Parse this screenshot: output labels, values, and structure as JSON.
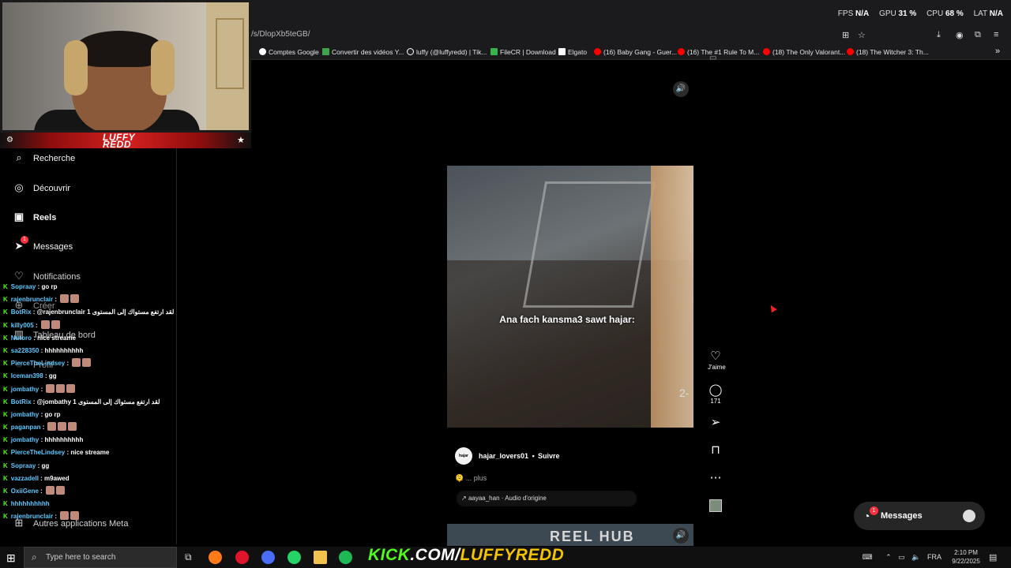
{
  "browser": {
    "url": "/s/DlopXb5teGB/",
    "bookmarks": [
      {
        "label": "Comptes Google",
        "icon": "google-icon"
      },
      {
        "label": "Convertir des vidéos Y...",
        "icon": "download-icon"
      },
      {
        "label": "luffy (@luffyredd) | Tik...",
        "icon": "tiktok-icon"
      },
      {
        "label": "FileCR | Download",
        "icon": "filecr-icon"
      },
      {
        "label": "Elgato",
        "icon": "elgato-icon"
      },
      {
        "label": "(16) Baby Gang - Guer...",
        "icon": "youtube-icon"
      },
      {
        "label": "(16) The #1 Rule To M...",
        "icon": "youtube-icon"
      },
      {
        "label": "(18) The Only Valorant...",
        "icon": "youtube-icon"
      },
      {
        "label": "(18) The Witcher 3: Th...",
        "icon": "youtube-icon"
      }
    ],
    "more_bookmarks": "»"
  },
  "perf": {
    "fps_label": "FPS",
    "fps_value": "N/A",
    "gpu_label": "GPU",
    "gpu_value": "31 %",
    "cpu_label": "CPU",
    "cpu_value": "68 %",
    "lat_label": "LAT",
    "lat_value": "N/A"
  },
  "stream": {
    "logo_line1": "LUFFY",
    "logo_line2": "REDD"
  },
  "nav": {
    "search": "Recherche",
    "explore": "Découvrir",
    "reels": "Reels",
    "messages": "Messages",
    "messages_badge": "1",
    "notifications": "Notifications",
    "create": "Créer",
    "dashboard": "Tableau de bord",
    "profile": "Profil",
    "meta": "Autres applications Meta"
  },
  "chat": [
    {
      "user": "Sopraay",
      "text": ": go rp",
      "emotes": 0
    },
    {
      "user": "rajenbrunclair",
      "text": ":",
      "emotes": 2
    },
    {
      "user": "BotRix",
      "text": ": @rajenbrunclair لقد ارتفع مستواك إلى المستوى 1",
      "emotes": 0
    },
    {
      "user": "killy005",
      "text": ":",
      "emotes": 2
    },
    {
      "user": "Nutoro",
      "text": ": nice streame",
      "emotes": 0
    },
    {
      "user": "sa228350",
      "text": ": hhhhhhhhhh",
      "emotes": 0
    },
    {
      "user": "PierceTheLindsey",
      "text": ":",
      "emotes": 2
    },
    {
      "user": "Iceman398",
      "text": ": gg",
      "emotes": 0
    },
    {
      "user": "jombathy",
      "text": ":",
      "emotes": 3
    },
    {
      "user": "BotRix",
      "text": ": @jombathy لقد ارتفع مستواك إلى المستوى 1",
      "emotes": 0
    },
    {
      "user": "jombathy",
      "text": ": go rp",
      "emotes": 0
    },
    {
      "user": "paganpan",
      "text": ":",
      "emotes": 3
    },
    {
      "user": "jombathy",
      "text": ": hhhhhhhhhh",
      "emotes": 0
    },
    {
      "user": "PierceTheLindsey",
      "text": ": nice streame",
      "emotes": 0
    },
    {
      "user": "Sopraay",
      "text": ": gg",
      "emotes": 0
    },
    {
      "user": "vazzadell",
      "text": ": m9awed",
      "emotes": 0
    },
    {
      "user": "OxiiGene",
      "text": ":",
      "emotes": 2
    },
    {
      "user": "hhhhhhhhhh",
      "text": "",
      "emotes": 0
    },
    {
      "user": "rajenbrunclair",
      "text": ":",
      "emotes": 2
    }
  ],
  "reel": {
    "caption": "Ana fach kansma3 sawt hajar:",
    "corner_mark": "2-",
    "likes_label": "J'aime",
    "comments_count": "171",
    "author": "hajar_lovers01",
    "author_avatar": "hajar",
    "separator": "•",
    "follow": "Suivre",
    "more": "... plus",
    "audio": "aayaa_han · Audio d'origine",
    "next_overlay": "REEL HUB"
  },
  "messages_pill": {
    "label": "Messages",
    "badge": "1"
  },
  "taskbar": {
    "search_placeholder": "Type here to search",
    "kick_prefix": "KICK",
    "kick_mid": ".COM/",
    "kick_name": "LUFFYREDD",
    "language": "FRA",
    "time": "2:10 PM",
    "date": "9/22/2025"
  },
  "colors": {
    "kick_green": "#53fc18",
    "kick_yellow": "#f5c400",
    "chat_user": "#5ec8ff",
    "badge_red": "#ff3040"
  }
}
